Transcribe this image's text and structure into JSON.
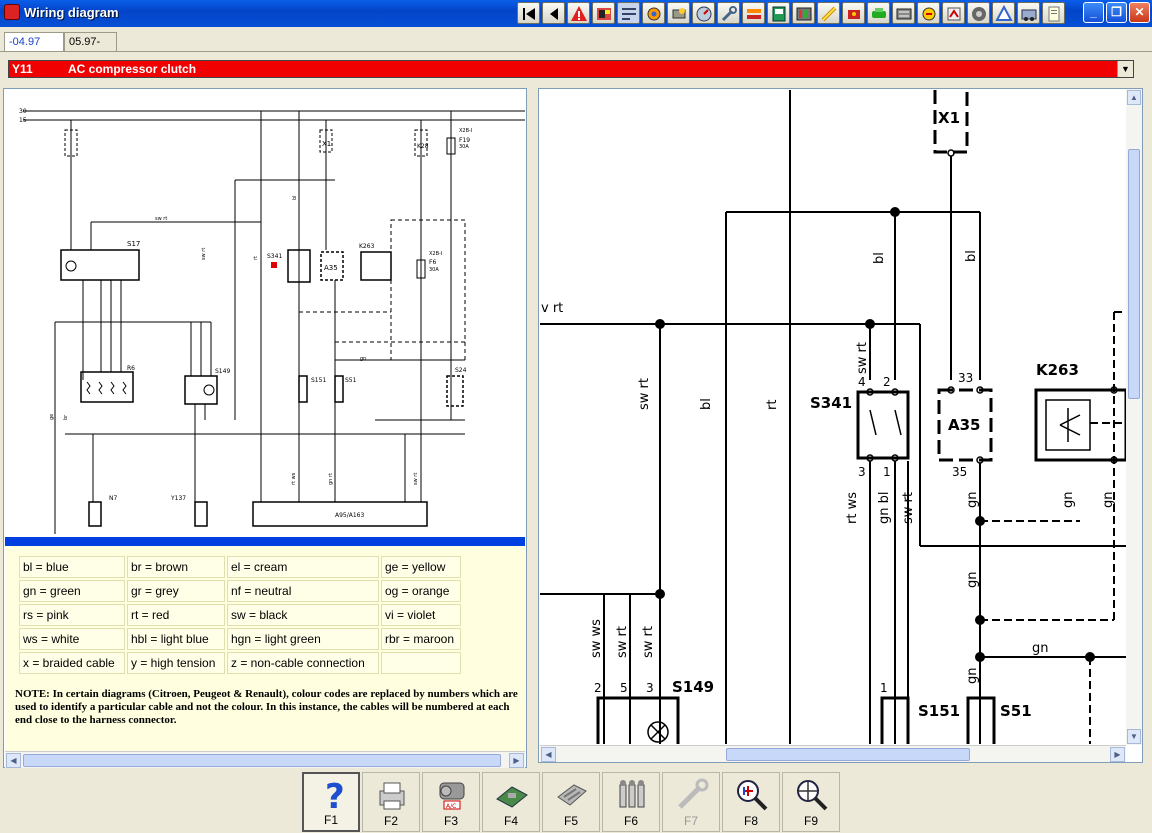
{
  "window": {
    "title": "Wiring diagram"
  },
  "toolbar_icons": [
    "first-page-icon",
    "prev-page-icon",
    "warning-icon",
    "notes-icon",
    "wiring-icon",
    "components-icon",
    "ecu-icon",
    "gauge-icon",
    "tools-icon",
    "jumper-icon",
    "module-icon",
    "fuse-box-icon",
    "schematic-icon",
    "probe-icon",
    "car-icon",
    "connector-icon",
    "harness-icon",
    "tester-icon",
    "ac-icon",
    "radio-icon",
    "location-icon",
    "switch-icon",
    "doc-icon"
  ],
  "tabs": [
    {
      "label": "-04.97"
    },
    {
      "label": "05.97-"
    }
  ],
  "component": {
    "code": "Y11",
    "name": "AC compressor clutch",
    "highlight_color": "#f00000"
  },
  "legend": [
    [
      "bl = blue",
      "br = brown",
      "el = cream",
      "ge = yellow"
    ],
    [
      "gn = green",
      "gr = grey",
      "nf = neutral",
      "og = orange"
    ],
    [
      "rs = pink",
      "rt = red",
      "sw = black",
      "vi = violet"
    ],
    [
      "ws = white",
      "hbl = light blue",
      "hgn = light green",
      "rbr = maroon"
    ],
    [
      "x = braided cable",
      "y = high tension",
      "z = non-cable connection",
      ""
    ]
  ],
  "note": "NOTE: In certain diagrams (Citroen, Peugeot & Renault), colour codes are replaced by numbers which are used to identify a particular cable and not the colour. In this instance, the cables will be numbered at each end close to the harness connector.",
  "left_diagram": {
    "bus_labels": [
      "30",
      "15"
    ],
    "components": [
      "S17",
      "S341",
      "A35",
      "K263",
      "F6",
      "F19",
      "R6",
      "S149",
      "S151",
      "S51",
      "S24",
      "N7",
      "Y137",
      "A95/A163",
      "X1",
      "K28"
    ],
    "fuse_labels": [
      "X2B-I",
      "30A",
      "X2B-I",
      "30A"
    ],
    "wire_labels": [
      "sw rt",
      "bl",
      "rt",
      "sw rt",
      "gn",
      "br",
      "ge",
      "rt ws",
      "gn rt",
      "sw rt"
    ]
  },
  "right_diagram": {
    "connector": "X1",
    "components": [
      "S341",
      "A35",
      "K263",
      "S149",
      "S151",
      "S51"
    ],
    "pin_numbers": [
      "4",
      "2",
      "3",
      "1",
      "33",
      "35",
      "2",
      "5",
      "3",
      "1"
    ],
    "wire_labels": [
      "v rt",
      "sw rt",
      "bl",
      "rt",
      "sw rt",
      "bl",
      "bl",
      "rt ws",
      "gn bl",
      "sw rt",
      "gn",
      "gn",
      "gn",
      "gn",
      "gn",
      "gn",
      "sw ws",
      "sw rt",
      "sw rt"
    ]
  },
  "function_keys": [
    {
      "label": "F1",
      "icon": "help-icon"
    },
    {
      "label": "F2",
      "icon": "print-icon"
    },
    {
      "label": "F3",
      "icon": "ac-compressor-icon"
    },
    {
      "label": "F4",
      "icon": "ecu-board-icon"
    },
    {
      "label": "F5",
      "icon": "connector-icon"
    },
    {
      "label": "F6",
      "icon": "fuses-icon"
    },
    {
      "label": "F7",
      "icon": "tool-icon"
    },
    {
      "label": "F8",
      "icon": "zoom-in-icon"
    },
    {
      "label": "F9",
      "icon": "zoom-out-icon"
    }
  ]
}
